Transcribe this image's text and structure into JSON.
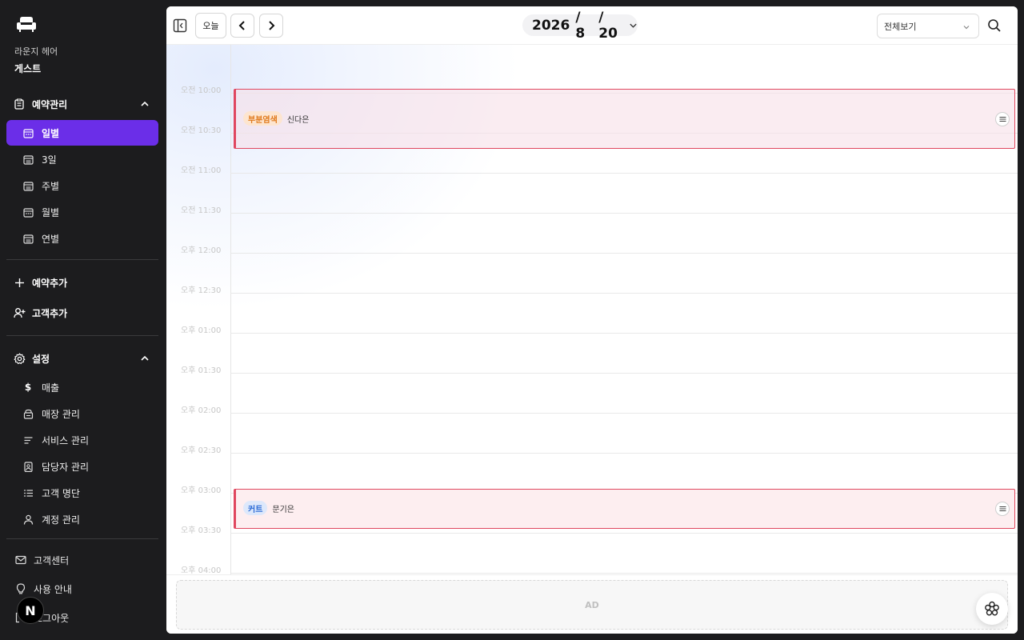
{
  "sidebar": {
    "shop_name": "라운지 헤어",
    "user_name": "게스트",
    "reservation_section": {
      "label": "예약관리",
      "items": [
        {
          "label": "일별",
          "icon": "calendar-icon",
          "active": true
        },
        {
          "label": "3일",
          "icon": "calendar-list-icon",
          "active": false
        },
        {
          "label": "주별",
          "icon": "calendar-list-icon",
          "active": false
        },
        {
          "label": "월별",
          "icon": "calendar-icon",
          "active": false
        },
        {
          "label": "연별",
          "icon": "calendar-list-icon",
          "active": false
        }
      ]
    },
    "actions": [
      {
        "label": "예약추가",
        "icon": "plus-icon"
      },
      {
        "label": "고객추가",
        "icon": "user-plus-icon"
      }
    ],
    "settings_section": {
      "label": "설정",
      "items": [
        {
          "label": "매출",
          "icon": "dollar-icon"
        },
        {
          "label": "매장 관리",
          "icon": "store-icon"
        },
        {
          "label": "서비스 관리",
          "icon": "list-lines-icon"
        },
        {
          "label": "담당자 관리",
          "icon": "badge-icon"
        },
        {
          "label": "고객 명단",
          "icon": "bullet-list-icon"
        },
        {
          "label": "계정 관리",
          "icon": "user-icon"
        }
      ]
    },
    "footer": [
      {
        "label": "고객센터",
        "icon": "mail-icon"
      },
      {
        "label": "사용 안내",
        "icon": "lightbulb-icon"
      },
      {
        "label": "로그아웃",
        "icon": "logout-icon"
      }
    ],
    "badge_letter": "N"
  },
  "toolbar": {
    "today_label": "오늘",
    "date": {
      "year": "2026",
      "month": "/ 8",
      "day": "/ 20"
    },
    "view_select": "전체보기"
  },
  "calendar": {
    "time_labels": [
      "오전 10:00",
      "오전 10:30",
      "오전 11:00",
      "오전 11:30",
      "오후 12:00",
      "오후 12:30",
      "오후 01:00",
      "오후 01:30",
      "오후 02:00",
      "오후 02:30",
      "오후 03:00",
      "오후 03:30",
      "오후 04:00"
    ],
    "events": [
      {
        "service": "부분염색",
        "customer": "신다은",
        "tag_color": "orange",
        "accent": "#e0475f"
      },
      {
        "service": "커트",
        "customer": "문기은",
        "tag_color": "blue",
        "accent": "#e0475f"
      }
    ]
  },
  "ad_label": "AD",
  "colors": {
    "accent": "#6b2ee8",
    "event_border": "#e0475f",
    "sidebar_bg": "#1c1c1e"
  }
}
